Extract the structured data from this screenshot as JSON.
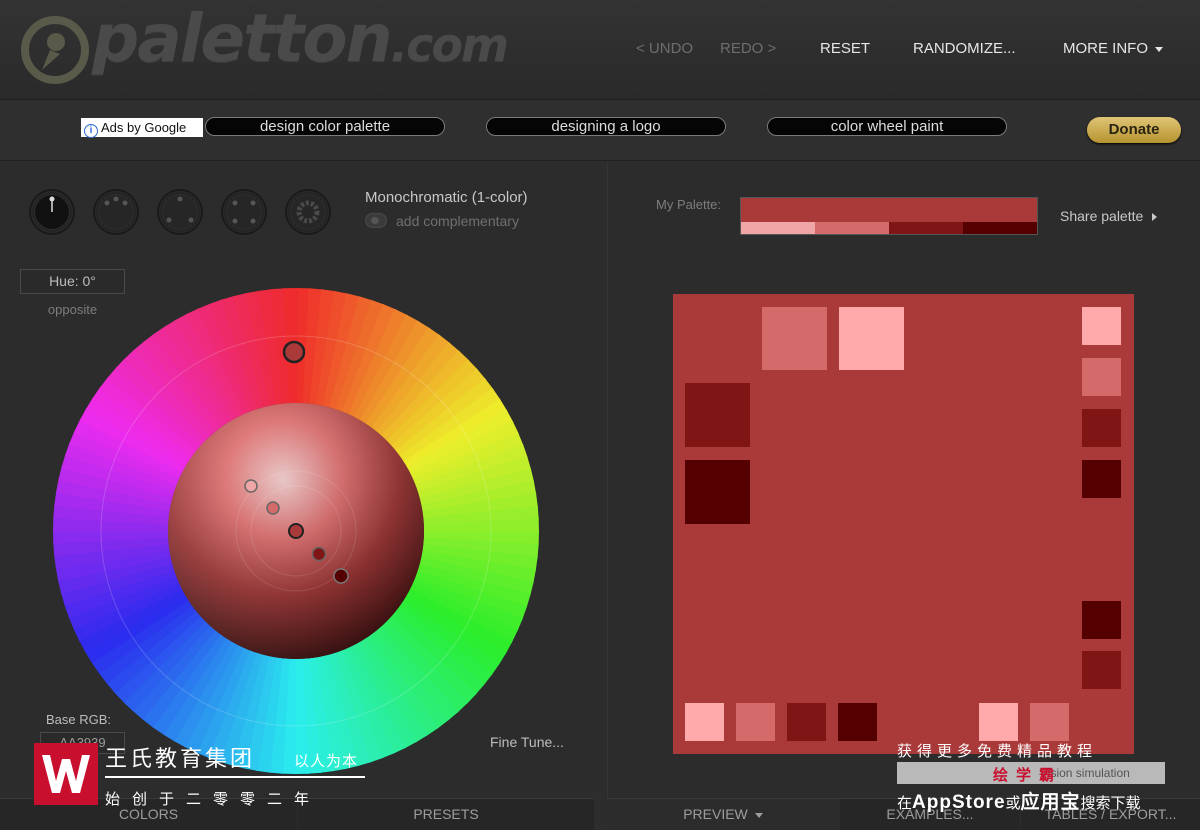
{
  "header": {
    "logo_text": "paletton",
    "logo_suffix": ".com",
    "nav": {
      "undo": "< UNDO",
      "redo": "REDO >",
      "reset": "RESET",
      "randomize": "RANDOMIZE...",
      "more_info": "MORE INFO"
    }
  },
  "ads": {
    "label": "Ads by Google",
    "links": [
      "design color palette",
      "designing a logo",
      "color wheel paint"
    ],
    "donate": "Donate"
  },
  "left": {
    "scheme_title": "Monochromatic (1-color)",
    "add_complementary": "add complementary",
    "hue": "Hue: 0°",
    "opposite": "opposite",
    "base_rgb_label": "Base RGB:",
    "base_rgb_value": "AA3939",
    "fine_tune": "Fine Tune..."
  },
  "right": {
    "my_palette_label": "My Palette:",
    "share_palette": "Share palette",
    "palette": {
      "main": "#AA3939",
      "shades": [
        "#F0A6A6",
        "#D46A6A",
        "#801515",
        "#550000"
      ]
    },
    "colors": {
      "base": "#AA3939",
      "lightest": "#FFAAAA",
      "light": "#D46A6A",
      "dark": "#801515",
      "darkest": "#550000"
    }
  },
  "tabs": {
    "colors": "COLORS",
    "presets": "PRESETS",
    "preview": "PREVIEW",
    "examples": "EXAMPLES...",
    "tables": "TABLES / EXPORT..."
  },
  "watermark": {
    "left_name": "王氏教育集团",
    "left_slogan": "以人为本",
    "left_sub": "始创于二零零二年",
    "right_top": "获得更多免费精品教程",
    "right_brand": "绘学霸",
    "right_bar_text": "Vision simulation",
    "right_bottom_prefix": "在",
    "right_bottom_app": "AppStore",
    "right_bottom_mid": "或",
    "right_bottom_app2": "应用宝",
    "right_bottom_suffix": "搜索下载"
  }
}
